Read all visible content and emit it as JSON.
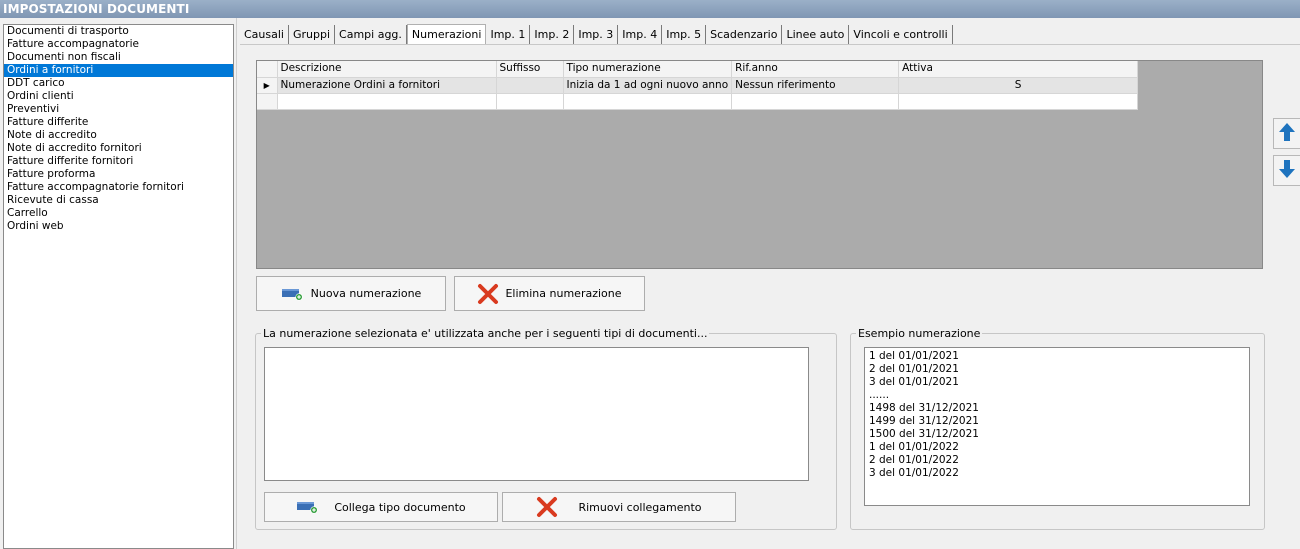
{
  "window": {
    "title": "IMPOSTAZIONI DOCUMENTI"
  },
  "doc_types": [
    "Documenti di trasporto",
    "Fatture accompagnatorie",
    "Documenti non fiscali",
    "Ordini a fornitori",
    "DDT carico",
    "Ordini clienti",
    "Preventivi",
    "Fatture differite",
    "Note di accredito",
    "Note di accredito fornitori",
    "Fatture differite fornitori",
    "Fatture proforma",
    "Fatture accompagnatorie fornitori",
    "Ricevute di cassa",
    "Carrello",
    "Ordini web"
  ],
  "selected_doc_type": "Ordini a fornitori",
  "tabs": [
    "Causali",
    "Gruppi",
    "Campi agg.",
    "Numerazioni",
    "Imp. 1",
    "Imp. 2",
    "Imp. 3",
    "Imp. 4",
    "Imp. 5",
    "Scadenzario",
    "Linee auto",
    "Vincoli e controlli"
  ],
  "active_tab": "Numerazioni",
  "grid": {
    "columns": [
      "Descrizione",
      "Suffisso",
      "Tipo numerazione",
      "Rif.anno",
      "Attiva"
    ],
    "rows": [
      {
        "indicator": "▶",
        "cells": [
          "Numerazione Ordini a fornitori",
          "",
          "Inizia da 1 ad ogni nuovo anno",
          "Nessun riferimento",
          "S"
        ]
      },
      {
        "indicator": "",
        "cells": [
          "",
          "",
          "",
          "",
          ""
        ]
      }
    ]
  },
  "buttons": {
    "new": "Nuova numerazione",
    "delete": "Elimina numerazione",
    "link": "Collega tipo documento",
    "unlink": "Rimuovi collegamento"
  },
  "linked_group": {
    "legend": "La numerazione selezionata e' utilizzata anche per i seguenti tipi di documenti..."
  },
  "example_group": {
    "legend": "Esempio numerazione",
    "lines": [
      "1 del 01/01/2021",
      "2 del 01/01/2021",
      "3 del 01/01/2021",
      "......",
      "1498 del 31/12/2021",
      "1499 del 31/12/2021",
      "1500 del 31/12/2021",
      "1 del 01/01/2022",
      "2 del 01/01/2022",
      "3 del 01/01/2022"
    ]
  },
  "colors": {
    "selection": "#0078d7",
    "grid_background": "#ababab",
    "move_arrow": "#1e73be",
    "delete_x": "#d93a1f"
  },
  "icons": {
    "move_up": "arrow-up-icon",
    "move_down": "arrow-down-icon",
    "add": "add-card-icon",
    "delete": "delete-x-icon"
  }
}
